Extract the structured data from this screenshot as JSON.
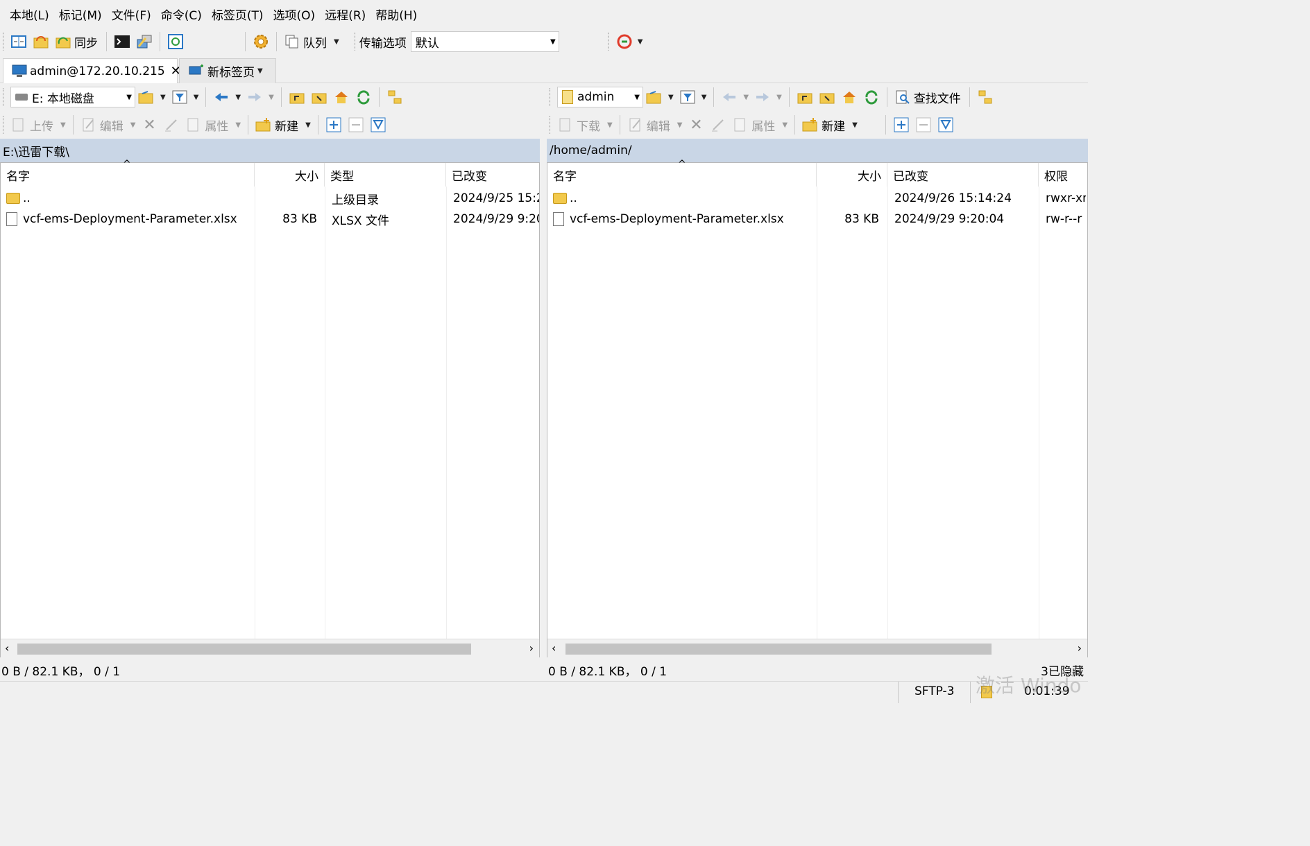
{
  "menu": [
    "本地(L)",
    "标记(M)",
    "文件(F)",
    "命令(C)",
    "标签页(T)",
    "选项(O)",
    "远程(R)",
    "帮助(H)"
  ],
  "main_toolbar": {
    "sync_label": "同步",
    "queue_label": "队列",
    "transfer_options_label": "传输选项",
    "transfer_options_value": "默认"
  },
  "tabs": {
    "session": "admin@172.20.10.215",
    "new_tab": "新标签页"
  },
  "local": {
    "drive": "E: 本地磁盘",
    "upload": "上传",
    "edit": "编辑",
    "properties": "属性",
    "new": "新建",
    "path": "E:\\迅雷下载\\",
    "columns": {
      "name": "名字",
      "size": "大小",
      "type": "类型",
      "changed": "已改变"
    },
    "rows": [
      {
        "name": "..",
        "size": "",
        "type": "上级目录",
        "changed": "2024/9/25 15:2"
      },
      {
        "name": "vcf-ems-Deployment-Parameter.xlsx",
        "size": "83 KB",
        "type": "XLSX 文件",
        "changed": "2024/9/29 9:20"
      }
    ],
    "status": "0 B / 82.1 KB， 0 / 1"
  },
  "remote": {
    "folder": "admin",
    "find_files": "查找文件",
    "download": "下载",
    "edit": "编辑",
    "properties": "属性",
    "new": "新建",
    "path": "/home/admin/",
    "columns": {
      "name": "名字",
      "size": "大小",
      "changed": "已改变",
      "rights": "权限"
    },
    "rows": [
      {
        "name": "..",
        "size": "",
        "changed": "2024/9/26 15:14:24",
        "rights": "rwxr-xr"
      },
      {
        "name": "vcf-ems-Deployment-Parameter.xlsx",
        "size": "83 KB",
        "changed": "2024/9/29 9:20:04",
        "rights": "rw-r--r"
      }
    ],
    "status": "0 B / 82.1 KB， 0 / 1",
    "hidden": "3已隐藏"
  },
  "statusbar": {
    "protocol": "SFTP-3",
    "elapsed": "0:01:39",
    "watermark": "激活 Windo"
  },
  "colors": {
    "path_bg": "#c9d6e6",
    "accent": "#2b78c5"
  }
}
